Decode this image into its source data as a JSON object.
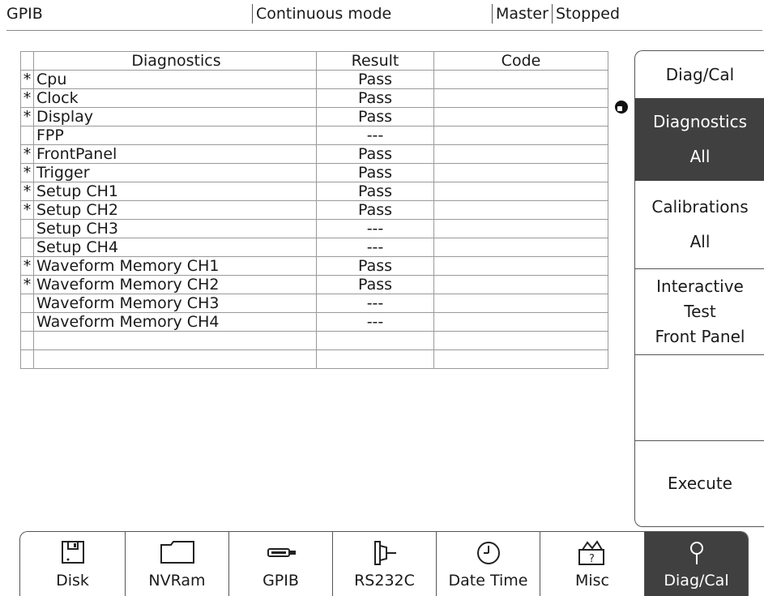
{
  "status_bar": {
    "interface": "GPIB",
    "mode": "Continuous mode",
    "role": "Master",
    "state": "Stopped"
  },
  "diagnostics_table": {
    "headers": [
      "Diagnostics",
      "Result",
      "Code"
    ],
    "rows": [
      {
        "mark": "*",
        "name": "Cpu",
        "result": "Pass",
        "code": ""
      },
      {
        "mark": "*",
        "name": "Clock",
        "result": "Pass",
        "code": ""
      },
      {
        "mark": "*",
        "name": "Display",
        "result": "Pass",
        "code": ""
      },
      {
        "mark": "",
        "name": "FPP",
        "result": "---",
        "code": ""
      },
      {
        "mark": "*",
        "name": "FrontPanel",
        "result": "Pass",
        "code": ""
      },
      {
        "mark": "*",
        "name": "Trigger",
        "result": "Pass",
        "code": ""
      },
      {
        "mark": "*",
        "name": "Setup CH1",
        "result": "Pass",
        "code": ""
      },
      {
        "mark": "*",
        "name": "Setup CH2",
        "result": "Pass",
        "code": ""
      },
      {
        "mark": "",
        "name": "Setup CH3",
        "result": "---",
        "code": ""
      },
      {
        "mark": "",
        "name": "Setup CH4",
        "result": "---",
        "code": ""
      },
      {
        "mark": "*",
        "name": "Waveform Memory  CH1",
        "result": "Pass",
        "code": ""
      },
      {
        "mark": "*",
        "name": "Waveform Memory  CH2",
        "result": "Pass",
        "code": ""
      },
      {
        "mark": "",
        "name": "Waveform Memory  CH3",
        "result": "---",
        "code": ""
      },
      {
        "mark": "",
        "name": "Waveform Memory  CH4",
        "result": "---",
        "code": ""
      },
      {
        "mark": "",
        "name": "",
        "result": "",
        "code": ""
      },
      {
        "mark": "",
        "name": "",
        "result": "",
        "code": ""
      }
    ]
  },
  "side_menu": {
    "title": "Diag/Cal",
    "diagnostics": {
      "line1": "Diagnostics",
      "line2": "All"
    },
    "calibrations": {
      "line1": "Calibrations",
      "line2": "All"
    },
    "interactive": {
      "line1": "Interactive",
      "line2": "Test",
      "line3": "Front Panel"
    },
    "execute": "Execute"
  },
  "bottom_tabs": [
    {
      "label": "Disk",
      "icon": "floppy-disk-icon"
    },
    {
      "label": "NVRam",
      "icon": "folder-icon"
    },
    {
      "label": "GPIB",
      "icon": "gpib-connector-icon"
    },
    {
      "label": "RS232C",
      "icon": "serial-connector-icon"
    },
    {
      "label": "Date Time",
      "icon": "clock-icon"
    },
    {
      "label": "Misc",
      "icon": "toolbox-icon"
    },
    {
      "label": "Diag/Cal",
      "icon": "probe-icon"
    }
  ],
  "colors": {
    "selected_bg": "#404040",
    "selected_fg": "#ffffff"
  }
}
